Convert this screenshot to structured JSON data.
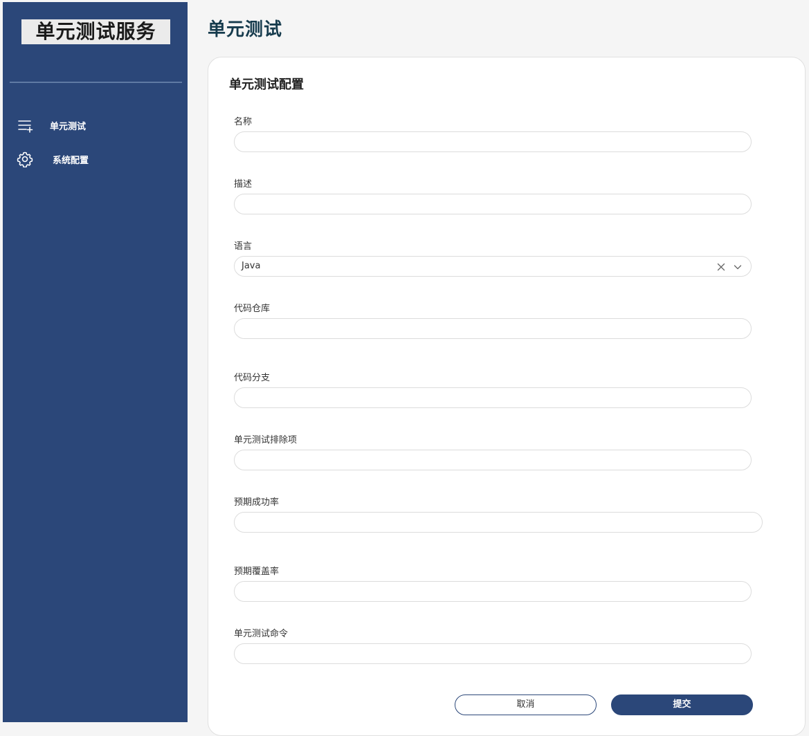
{
  "sidebar": {
    "brand": "单元测试服务",
    "items": [
      {
        "label": "单元测试",
        "icon": "list-add-icon"
      },
      {
        "label": "系统配置",
        "icon": "gear-icon"
      }
    ]
  },
  "header": {
    "title": "单元测试"
  },
  "form": {
    "title": "单元测试配置",
    "fields": {
      "name": {
        "label": "名称",
        "value": ""
      },
      "description": {
        "label": "描述",
        "value": ""
      },
      "language": {
        "label": "语言",
        "value": "Java"
      },
      "repo": {
        "label": "代码仓库",
        "value": ""
      },
      "branch": {
        "label": "代码分支",
        "value": ""
      },
      "exclusions": {
        "label": "单元测试排除项",
        "value": ""
      },
      "success_rate": {
        "label": "预期成功率",
        "value": ""
      },
      "coverage_rate": {
        "label": "预期覆盖率",
        "value": ""
      },
      "command": {
        "label": "单元测试命令",
        "value": ""
      }
    },
    "cancel_label": "取消",
    "submit_label": "提交"
  },
  "colors": {
    "sidebar_bg": "#2b4779",
    "title_color": "#163b4d",
    "primary": "#2b4779"
  }
}
